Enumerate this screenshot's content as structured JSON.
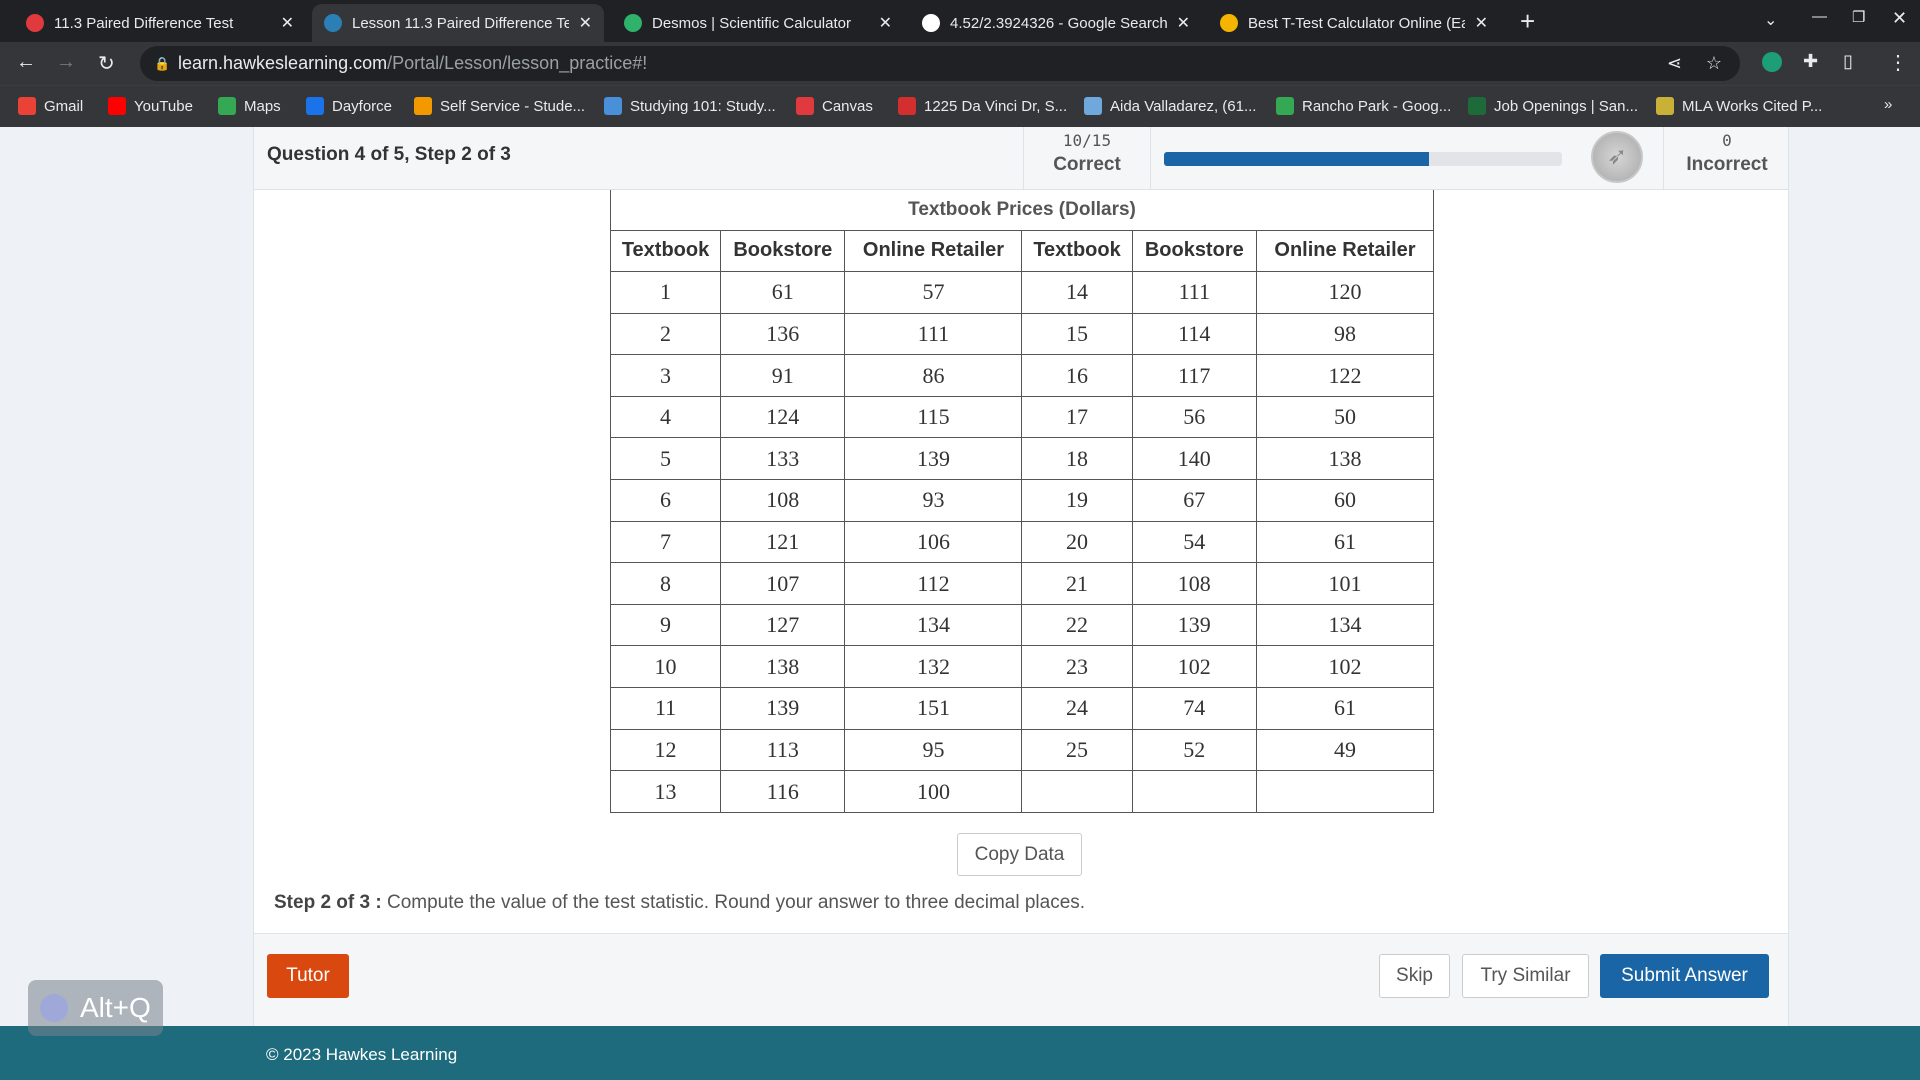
{
  "browser": {
    "tabs": [
      {
        "title": "11.3 Paired Difference Test",
        "icon": "canvas-icon",
        "color": "#e03a3e"
      },
      {
        "title": "Lesson 11.3 Paired Difference Te",
        "icon": "hawkes-icon",
        "color": "#2b7fb5",
        "active": true
      },
      {
        "title": "Desmos | Scientific Calculator",
        "icon": "desmos-icon",
        "color": "#2fb26b"
      },
      {
        "title": "4.52/2.3924326 - Google Search",
        "icon": "google-icon",
        "color": "#ffffff"
      },
      {
        "title": "Best T-Test Calculator Online (Ea",
        "icon": "calculator-icon",
        "color": "#f4b400"
      }
    ],
    "url_host": "learn.hawkeslearning.com",
    "url_path": "/Portal/Lesson/lesson_practice#!",
    "bookmarks": [
      {
        "label": "Gmail",
        "color": "#ea4335"
      },
      {
        "label": "YouTube",
        "color": "#ff0000"
      },
      {
        "label": "Maps",
        "color": "#34a853"
      },
      {
        "label": "Dayforce",
        "color": "#1a73e8"
      },
      {
        "label": "Self Service - Stude...",
        "color": "#f29900"
      },
      {
        "label": "Studying 101: Study...",
        "color": "#4a90d9"
      },
      {
        "label": "Canvas",
        "color": "#e03a3e"
      },
      {
        "label": "1225 Da Vinci Dr, S...",
        "color": "#d32f2f"
      },
      {
        "label": "Aida Valladarez, (61...",
        "color": "#6fa8dc"
      },
      {
        "label": "Rancho Park - Goog...",
        "color": "#34a853"
      },
      {
        "label": "Job Openings | San...",
        "color": "#1e6b3a"
      },
      {
        "label": "MLA Works Cited P...",
        "color": "#c9b037"
      }
    ],
    "more": "»"
  },
  "header": {
    "question": "Question 4 of 5,  Step 2 of 3",
    "correct_count": "10/15",
    "correct_label": "Correct",
    "progress": 0.6667,
    "incorrect_count": "0",
    "incorrect_label": "Incorrect"
  },
  "table": {
    "title": "Textbook Prices (Dollars)",
    "headers": [
      "Textbook",
      "Bookstore",
      "Online Retailer",
      "Textbook",
      "Bookstore",
      "Online Retailer"
    ],
    "rows": [
      [
        "1",
        "61",
        "57",
        "14",
        "111",
        "120"
      ],
      [
        "2",
        "136",
        "111",
        "15",
        "114",
        "98"
      ],
      [
        "3",
        "91",
        "86",
        "16",
        "117",
        "122"
      ],
      [
        "4",
        "124",
        "115",
        "17",
        "56",
        "50"
      ],
      [
        "5",
        "133",
        "139",
        "18",
        "140",
        "138"
      ],
      [
        "6",
        "108",
        "93",
        "19",
        "67",
        "60"
      ],
      [
        "7",
        "121",
        "106",
        "20",
        "54",
        "61"
      ],
      [
        "8",
        "107",
        "112",
        "21",
        "108",
        "101"
      ],
      [
        "9",
        "127",
        "134",
        "22",
        "139",
        "134"
      ],
      [
        "10",
        "138",
        "132",
        "23",
        "102",
        "102"
      ],
      [
        "11",
        "139",
        "151",
        "24",
        "74",
        "61"
      ],
      [
        "12",
        "113",
        "95",
        "25",
        "52",
        "49"
      ],
      [
        "13",
        "116",
        "100",
        "",
        "",
        ""
      ]
    ]
  },
  "copy_data": "Copy Data",
  "step": {
    "label": "Step 2 of 3 :",
    "text": " Compute the value of the test statistic. Round your answer to three decimal places."
  },
  "buttons": {
    "tutor": "Tutor",
    "skip": "Skip",
    "try_similar": "Try Similar",
    "submit": "Submit Answer"
  },
  "footer": "© 2023 Hawkes Learning",
  "overlay": "Alt+Q",
  "colors": {
    "accent": "#1a65a6",
    "tutor": "#d9480f",
    "footer": "#1d6b7d"
  }
}
